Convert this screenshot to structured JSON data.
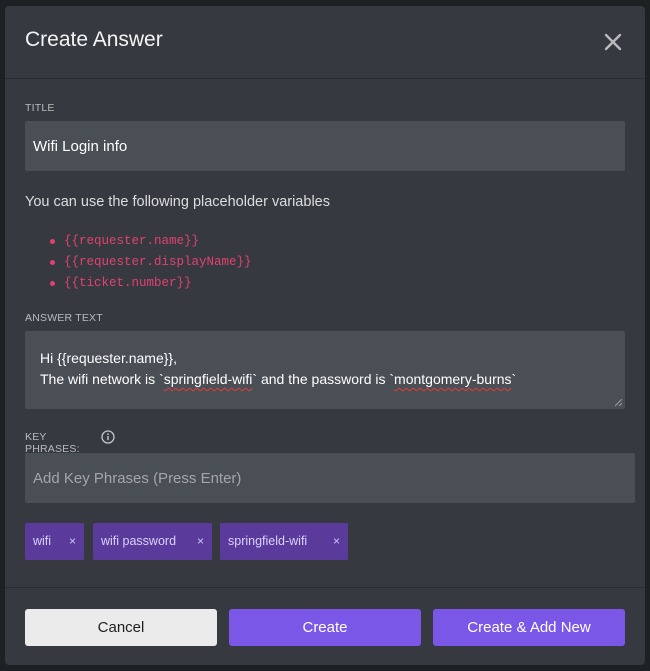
{
  "dialog": {
    "title": "Create Answer"
  },
  "title_field": {
    "label": "TITLE",
    "value": "Wifi Login info"
  },
  "placeholders": {
    "hint": "You can use the following placeholder variables",
    "items": [
      "{{requester.name}}",
      "{{requester.displayName}}",
      "{{ticket.number}}"
    ],
    "color": "#e2416f"
  },
  "answer_field": {
    "label": "ANSWER TEXT",
    "line1": "Hi {{requester.name}},",
    "line2_a": "The wifi network is `",
    "line2_b": "springfield-wifi",
    "line2_c": "` and the password is `",
    "line2_d": "montgomery-burns",
    "line2_e": "`"
  },
  "key_phrases": {
    "label": "KEY PHRASES:",
    "placeholder": "Add Key Phrases (Press Enter)",
    "chips": [
      "wifi",
      "wifi password",
      "springfield-wifi"
    ],
    "remove_symbol": "×",
    "chip_color": "#5a3b9c"
  },
  "footer": {
    "cancel_label": "Cancel",
    "create_label": "Create",
    "create_add_label": "Create & Add New",
    "accent": "#7b57e8"
  },
  "icons": {
    "close": "close-icon",
    "info": "info-icon",
    "resize": "resize-handle-icon"
  }
}
